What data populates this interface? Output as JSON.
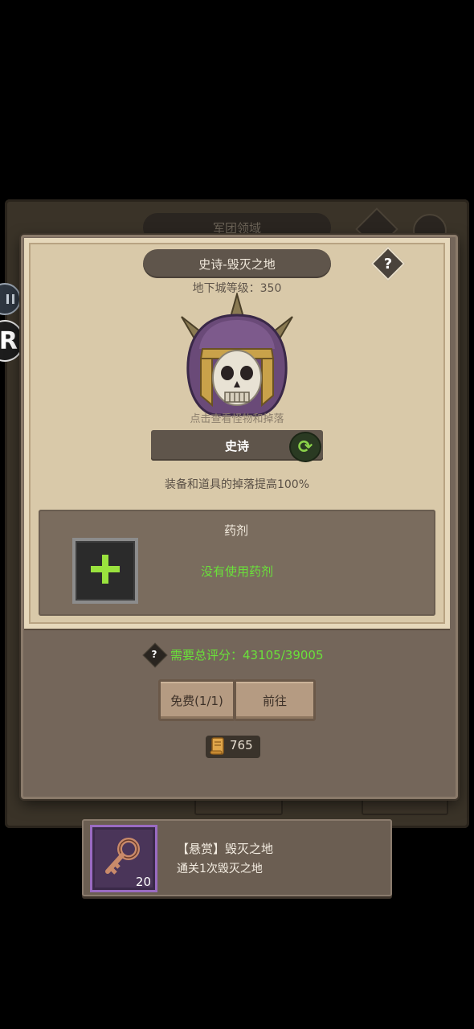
{
  "background": {
    "title": "军团领域",
    "left_button": "",
    "right_button": ""
  },
  "dialog": {
    "title": "史诗-毁灭之地",
    "dungeon_level": "地下城等级：350",
    "click_hint": "点击查看怪物和掉落",
    "difficulty": "史诗",
    "drop_boost": "装备和道具的掉落提高100%",
    "potion": {
      "title": "药剂",
      "status": "没有使用药剂"
    },
    "requirement": "需要总评分：43105/39005",
    "free_button": "免费(1/1)",
    "goto_button": "前往",
    "scroll_count": "765",
    "help_label": "?"
  },
  "bounty": {
    "title": "【悬赏】毁灭之地",
    "description": "通关1次毁灭之地",
    "reward_count": "20"
  },
  "colors": {
    "accent_green": "#6ae13a",
    "parchment": "#d9c9a9",
    "panel": "#7a6c5e"
  },
  "icons": [
    "pause-icon",
    "r-icon",
    "help-icon",
    "refresh-icon",
    "plus-icon",
    "scroll-icon",
    "key-icon",
    "skull-helmet-icon",
    "menu-icon"
  ]
}
